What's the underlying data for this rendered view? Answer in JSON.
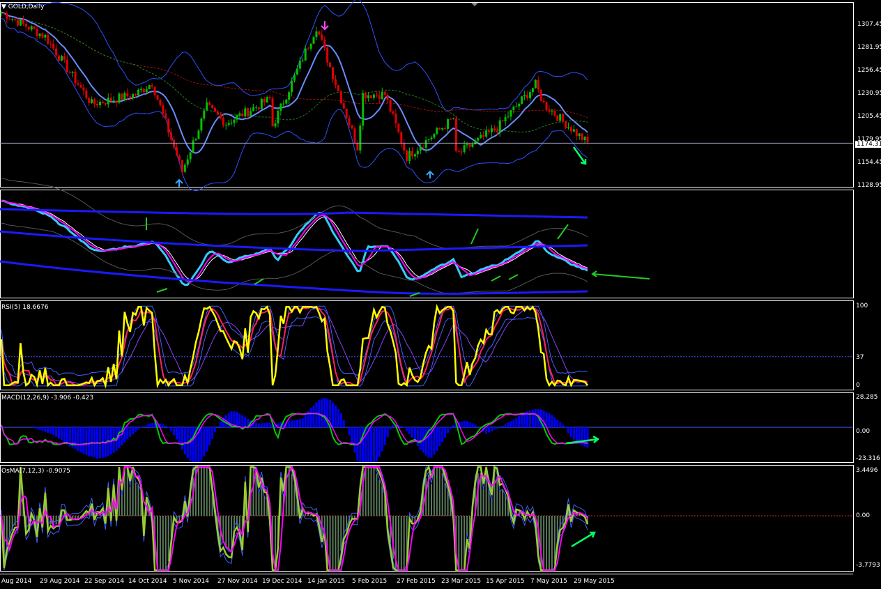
{
  "symbol_title": "GOLD,Daily",
  "colors": {
    "background": "#000000",
    "grid_frame": "#ffffff",
    "bull": "#00c000",
    "bear": "#e00000",
    "bollinger": "#3050ff",
    "ma_fast": "#6a8cff",
    "rsi_main": "#ffff00",
    "rsi_signal": "#ff00ff",
    "macd_hist": "#0000ff",
    "macd_main": "#00c000",
    "osma_line": "#9acd32",
    "arrow_green": "#22cc22",
    "arrow_bright": "#00ff66"
  },
  "chart_data": [
    {
      "type": "candlestick",
      "title": "GOLD,Daily",
      "yticks": [
        "1307.45",
        "1281.95",
        "1256.45",
        "1230.95",
        "1205.45",
        "1179.95",
        "1154.45",
        "1128.95"
      ],
      "ylim": [
        1128.95,
        1320
      ],
      "current_price": "1174.31",
      "close_path": {
        "x_dates": [
          "Aug 2014",
          "29 Aug 2014",
          "22 Sep 2014",
          "14 Oct 2014",
          "5 Nov 2014",
          "27 Nov 2014",
          "19 Dec 2014",
          "14 Jan 2015",
          "5 Feb 2015",
          "27 Feb 2015",
          "23 Mar 2015",
          "15 Apr 2015",
          "7 May 2015",
          "29 May 2015"
        ],
        "close": [
          1310,
          1285,
          1215,
          1225,
          1145,
          1195,
          1192,
          1295,
          1225,
          1160,
          1200,
          1190,
          1215,
          1174.31
        ]
      }
    },
    {
      "type": "line",
      "title": "",
      "note": "Oscillator pane with bands (no label shown)"
    },
    {
      "type": "line",
      "title": "RSI(5) 18.6676",
      "yticks": [
        "100",
        "37",
        "0"
      ],
      "ylim": [
        0,
        100
      ],
      "level": 37
    },
    {
      "type": "bar",
      "title": "MACD(12,26,9) -3.906 -0.423",
      "yticks": [
        "28.285",
        "0.00",
        "-23.316"
      ],
      "ylim": [
        -23.316,
        28.285
      ]
    },
    {
      "type": "bar",
      "title": "OsMA(7,12,3) -0.9075",
      "yticks": [
        "3.4496",
        "0.00",
        "-3.7793"
      ],
      "ylim": [
        -3.7793,
        3.4496
      ]
    }
  ],
  "x_axis_labels": [
    "Aug 2014",
    "29 Aug 2014",
    "22 Sep 2014",
    "14 Oct 2014",
    "5 Nov 2014",
    "27 Nov 2014",
    "19 Dec 2014",
    "14 Jan 2015",
    "5 Feb 2015",
    "27 Feb 2015",
    "23 Mar 2015",
    "15 Apr 2015",
    "7 May 2015",
    "29 May 2015"
  ]
}
